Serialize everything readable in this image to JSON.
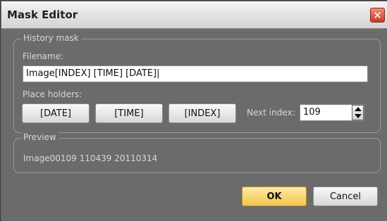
{
  "window": {
    "title": "Mask Editor",
    "close_glyph": "✕"
  },
  "history": {
    "legend": "History mask",
    "filename_label": "Filename:",
    "filename_value": "Image[INDEX] [TIME] [DATE]|",
    "placeholders_label": "Place holders:",
    "buttons": [
      "[DATE]",
      "[TIME]",
      "[INDEX]"
    ],
    "next_index_label": "Next index:",
    "next_index_value": "109"
  },
  "preview": {
    "legend": "Preview",
    "text": "Image00109 110439 20110314"
  },
  "footer": {
    "ok": "OK",
    "cancel": "Cancel"
  }
}
